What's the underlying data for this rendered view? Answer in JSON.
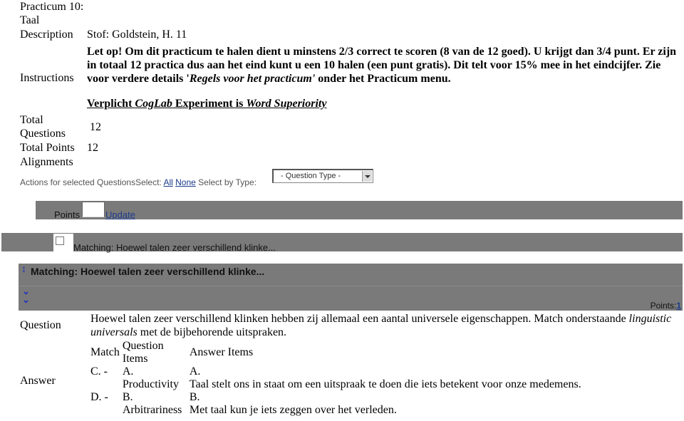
{
  "title": "Practicum 10: Taal",
  "description": {
    "label": "Description",
    "value": "Stof: Goldstein, H. 11"
  },
  "instructions": {
    "label": "Instructions",
    "part1": "Let op! Om dit practicum te halen dient u minstens 2/3 correct te scoren (8 van de 12 goed). U krijgt dan 3/4 punt. Er zijn in totaal 12 practica dus aan het eind kunt u een 10 halen (een punt gratis). Dit telt voor 15% mee in het eindcijfer. Zie voor verdere details '",
    "italic": "Regels voor het practicum'",
    "part2": " onder het Practicum menu.",
    "coglab_a": "Verplicht ",
    "coglab_b": "CogLab",
    "coglab_c": " Experiment is ",
    "coglab_d": "Word Superiority"
  },
  "totals": {
    "questions_label": "Total Questions",
    "questions_value": "12",
    "points_label": "Total Points",
    "points_value": "12",
    "alignments_label": "Alignments"
  },
  "actions": {
    "prefix": "Actions for selected QuestionsSelect: ",
    "all": "All",
    "none": "None",
    "by_type": " Select by Type:",
    "question_type_selected": "- Question Type -"
  },
  "points_bar": {
    "label": "Points",
    "input_value": "",
    "update": "Update"
  },
  "question_row": {
    "title": "Matching: Hoewel talen zeer verschillend klinke...",
    "checked": false
  },
  "question": {
    "header": "Matching: Hoewel talen zeer verschillend klinke...",
    "points_label": "Points:",
    "points_value": "1",
    "question_label": "Question",
    "text_a": "Hoewel talen zeer verschillend klinken hebben zij allemaal een aantal universele eigenschappen. Match onderstaande ",
    "text_b": "linguistic universals",
    "text_c": " met de bijbehorende uitspraken.",
    "answer_label": "Answer",
    "table_headers": {
      "match": "Match",
      "question_items": "Question Items",
      "answer_items": "Answer Items"
    },
    "rows": [
      {
        "match": "C. -",
        "q_letter": "A.",
        "q_item": "Productivity",
        "a_letter": "A.",
        "a_item": "Taal stelt ons in staat om een uitspraak te doen die iets betekent voor onze medemens."
      },
      {
        "match": "D. -",
        "q_letter": "B.",
        "q_item": "Arbitrariness",
        "a_letter": "B.",
        "a_item": "Met taal kun je iets zeggen over het verleden."
      }
    ]
  },
  "colors": {
    "bar_gray": "#7a7a7a",
    "link_blue": "#1a3a8a",
    "icon_blue": "#2030c0"
  }
}
